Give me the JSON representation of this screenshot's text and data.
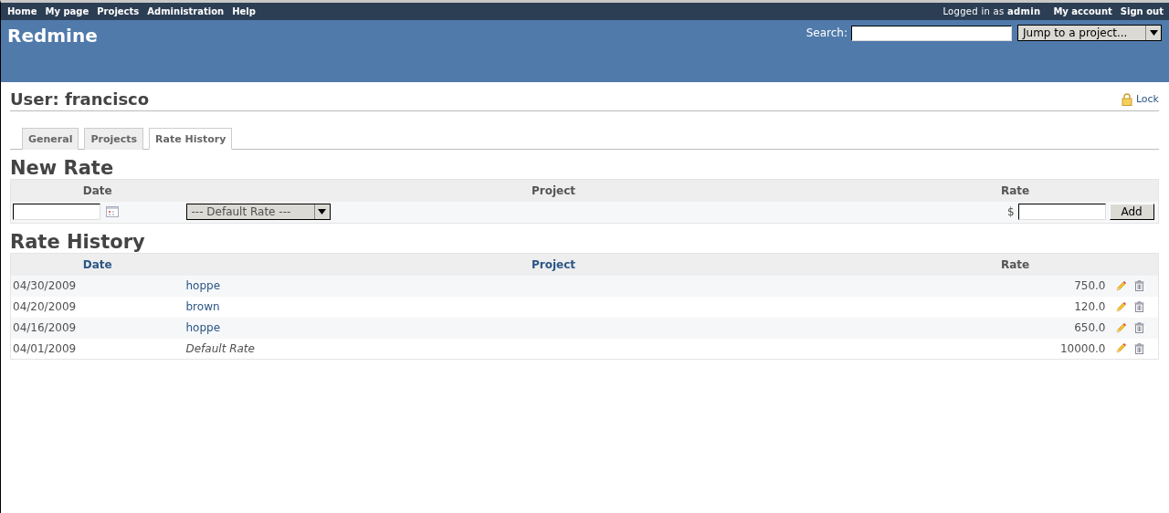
{
  "top_menu": {
    "left": [
      "Home",
      "My page",
      "Projects",
      "Administration",
      "Help"
    ],
    "logged_in_prefix": "Logged in as",
    "logged_in_user": "admin",
    "right": [
      "My account",
      "Sign out"
    ]
  },
  "header": {
    "title": "Redmine",
    "search_label": "Search:",
    "jump_label": "Jump to a project..."
  },
  "page": {
    "title": "User: francisco",
    "lock_label": "Lock"
  },
  "tabs": [
    {
      "label": "General",
      "selected": false
    },
    {
      "label": "Projects",
      "selected": false
    },
    {
      "label": "Rate History",
      "selected": true
    }
  ],
  "new_rate": {
    "heading": "New Rate",
    "columns": [
      "Date",
      "Project",
      "Rate"
    ],
    "project_select": "--- Default Rate ---",
    "currency": "$",
    "add_button": "Add"
  },
  "rate_history": {
    "heading": "Rate History",
    "columns": [
      "Date",
      "Project",
      "Rate"
    ],
    "rows": [
      {
        "date": "04/30/2009",
        "project": "hoppe",
        "kind": "link",
        "rate": "750.0"
      },
      {
        "date": "04/20/2009",
        "project": "brown",
        "kind": "link",
        "rate": "120.0"
      },
      {
        "date": "04/16/2009",
        "project": "hoppe",
        "kind": "link",
        "rate": "650.0"
      },
      {
        "date": "04/01/2009",
        "project": "Default Rate",
        "kind": "default",
        "rate": "10000.0"
      }
    ]
  }
}
